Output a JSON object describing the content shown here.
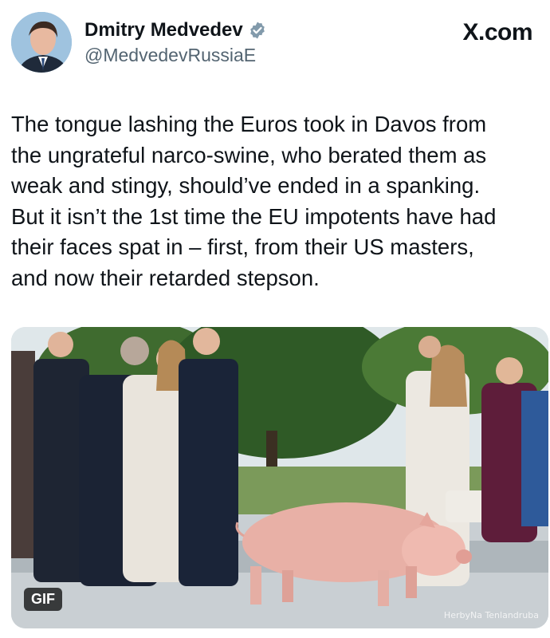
{
  "author": {
    "name": "Dmitry Medvedev",
    "handle": "@MedvedevRussiaE",
    "verified_icon": "verified-badge-icon"
  },
  "brand": "X.com",
  "post": {
    "text": "The tongue lashing the Euros took in Davos from\nthe ungrateful narco-swine, who berated them as\nweak and stingy, should’ve ended in a spanking.\nBut it isn’t the 1st time the EU impotents have had\ntheir faces spat in – first, from their US masters,\nand now their retarded stepson."
  },
  "media": {
    "type_badge": "GIF",
    "watermark": "HerbyNa Tenlandruba"
  },
  "colors": {
    "text": "#0f1419",
    "secondary_text": "#536471",
    "verified": "#829aab"
  }
}
